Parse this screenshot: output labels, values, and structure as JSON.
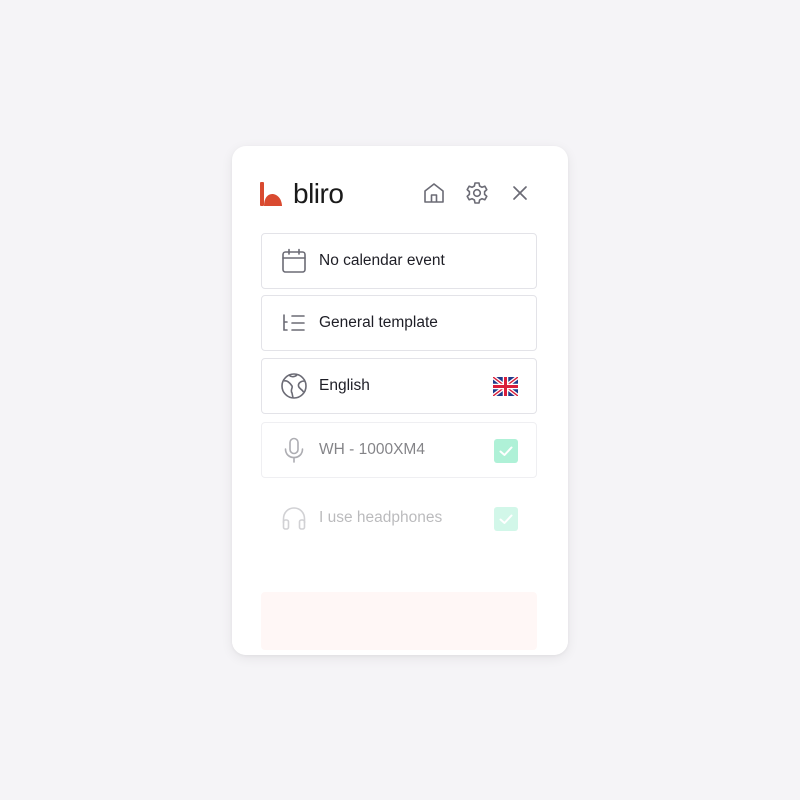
{
  "app": {
    "brand": "bliro",
    "brand_color": "#d94a30"
  },
  "header": {
    "icons": [
      "home-icon",
      "gear-icon",
      "close-icon"
    ]
  },
  "settings": {
    "calendar": {
      "label": "No calendar event",
      "icon": "calendar-icon"
    },
    "template": {
      "label": "General template",
      "icon": "list-icon"
    },
    "language": {
      "label": "English",
      "icon": "globe-icon",
      "flag": "uk-flag-icon"
    },
    "microphone": {
      "label": "WH - 1000XM4",
      "icon": "microphone-icon",
      "checked": true
    },
    "headphones": {
      "label": "I use headphones",
      "icon": "headphones-icon",
      "checked": true
    }
  },
  "colors": {
    "check": "#6ee7b7",
    "background": "#f5f4f7"
  }
}
